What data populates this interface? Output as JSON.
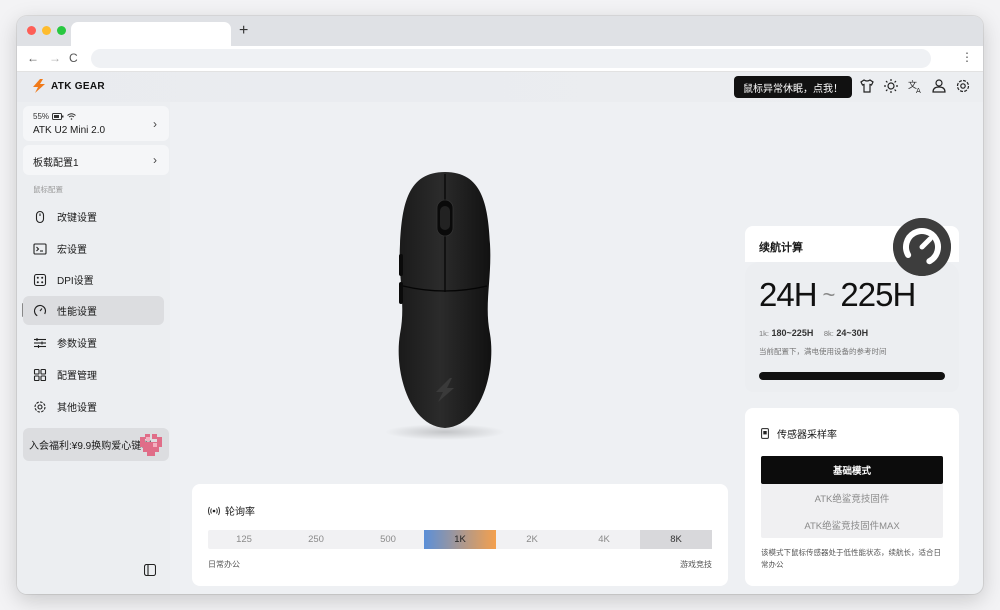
{
  "app": {
    "brand": "ATK GEAR",
    "notice": "鼠标异常休眠，点我！"
  },
  "device": {
    "battery": "55%",
    "name": "ATK U2 Mini 2.0"
  },
  "profile": {
    "name": "板载配置1"
  },
  "sidebar": {
    "section_label": "鼠标配置",
    "items": [
      {
        "label": "改键设置",
        "icon": "mouse-icon"
      },
      {
        "label": "宏设置",
        "icon": "terminal-icon"
      },
      {
        "label": "DPI设置",
        "icon": "dpi-icon"
      },
      {
        "label": "性能设置",
        "icon": "gauge-icon",
        "active": true
      },
      {
        "label": "参数设置",
        "icon": "sliders-icon"
      },
      {
        "label": "配置管理",
        "icon": "grid-icon"
      },
      {
        "label": "其他设置",
        "icon": "gear-icon"
      }
    ],
    "promo": "入会福利:¥9.9换购爱心键帽"
  },
  "polling": {
    "title": "轮询率",
    "rates": [
      "125",
      "250",
      "500",
      "1K",
      "2K",
      "4K",
      "8K"
    ],
    "selected": "1K",
    "left_caption": "日常办公",
    "right_caption": "游戏竞技"
  },
  "battery_calc": {
    "title": "续航计算",
    "min": "24H",
    "tilde": "~",
    "max": "225H",
    "line1_key": "1k:",
    "line1_val": "180~225H",
    "line2_key": "8k:",
    "line2_val": "24~30H",
    "note": "当前配置下，满电使用设备的参考时间"
  },
  "sensor": {
    "title": "传感器采样率",
    "modes": [
      "基础模式",
      "ATK绝鲨竞技固件",
      "ATK绝鲨竞技固件MAX"
    ],
    "selected": "基础模式",
    "description": "该模式下鼠标传感器处于低性能状态，续航长，适合日常办公"
  },
  "colors": {
    "accent_dark": "#0c0c0c",
    "rate_gradient_start": "#5b8fd8",
    "rate_gradient_end": "#f4a04d"
  }
}
